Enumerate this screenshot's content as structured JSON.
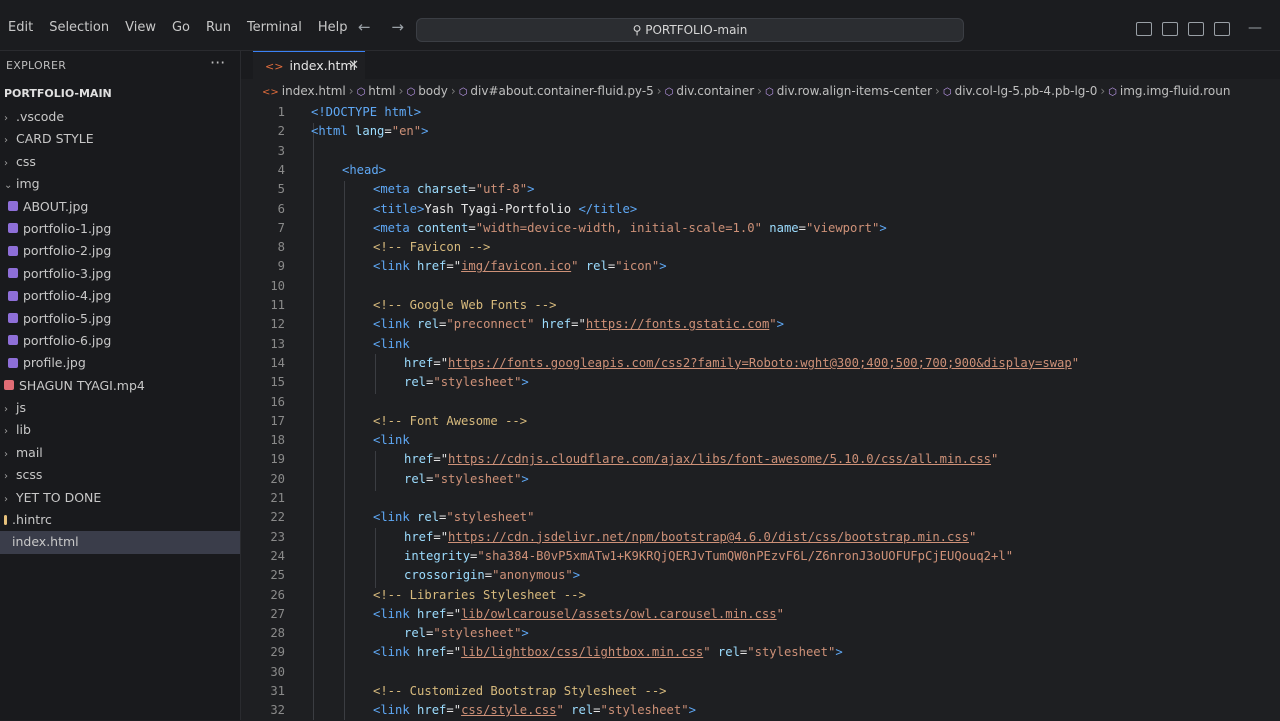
{
  "menu": [
    "Edit",
    "Selection",
    "View",
    "Go",
    "Run",
    "Terminal",
    "Help"
  ],
  "search": {
    "label": "PORTFOLIO-main"
  },
  "sidebar": {
    "header": "EXPLORER",
    "root": "PORTFOLIO-MAIN",
    "items": [
      {
        "label": ".vscode",
        "kind": "folder",
        "level": 0,
        "expanded": false
      },
      {
        "label": "CARD STYLE",
        "kind": "folder",
        "level": 0,
        "expanded": false
      },
      {
        "label": "css",
        "kind": "folder",
        "level": 0,
        "expanded": false
      },
      {
        "label": "img",
        "kind": "folder",
        "level": 0,
        "expanded": true
      },
      {
        "label": "ABOUT.jpg",
        "kind": "image",
        "level": 1
      },
      {
        "label": "portfolio-1.jpg",
        "kind": "image",
        "level": 1
      },
      {
        "label": "portfolio-2.jpg",
        "kind": "image",
        "level": 1
      },
      {
        "label": "portfolio-3.jpg",
        "kind": "image",
        "level": 1
      },
      {
        "label": "portfolio-4.jpg",
        "kind": "image",
        "level": 1
      },
      {
        "label": "portfolio-5.jpg",
        "kind": "image",
        "level": 1
      },
      {
        "label": "portfolio-6.jpg",
        "kind": "image",
        "level": 1
      },
      {
        "label": "profile.jpg",
        "kind": "image",
        "level": 1
      },
      {
        "label": "SHAGUN TYAGI.mp4",
        "kind": "video",
        "level": 0
      },
      {
        "label": "js",
        "kind": "folder",
        "level": 0,
        "expanded": false
      },
      {
        "label": "lib",
        "kind": "folder",
        "level": 0,
        "expanded": false
      },
      {
        "label": "mail",
        "kind": "folder",
        "level": 0,
        "expanded": false
      },
      {
        "label": "scss",
        "kind": "folder",
        "level": 0,
        "expanded": false
      },
      {
        "label": "YET TO DONE",
        "kind": "folder",
        "level": 0,
        "expanded": false
      },
      {
        "label": ".hintrc",
        "kind": "config",
        "level": 0
      },
      {
        "label": "index.html",
        "kind": "html",
        "level": 0,
        "active": true
      }
    ]
  },
  "tab": {
    "label": "index.html"
  },
  "breadcrumb": [
    "index.html",
    "html",
    "body",
    "div#about.container-fluid.py-5",
    "div.container",
    "div.row.align-items-center",
    "div.col-lg-5.pb-4.pb-lg-0",
    "img.img-fluid.roun"
  ],
  "code": [
    {
      "n": 1,
      "indent": 0,
      "parts": [
        [
          "tag",
          "<!DOCTYPE html>"
        ]
      ]
    },
    {
      "n": 2,
      "indent": 0,
      "parts": [
        [
          "tag",
          "<html "
        ],
        [
          "attr",
          "lang"
        ],
        [
          "plain",
          "="
        ],
        [
          "val",
          "\"en\""
        ],
        [
          "tag",
          ">"
        ]
      ]
    },
    {
      "n": 3,
      "indent": 0,
      "parts": []
    },
    {
      "n": 4,
      "indent": 1,
      "parts": [
        [
          "tag",
          "<head>"
        ]
      ]
    },
    {
      "n": 5,
      "indent": 2,
      "parts": [
        [
          "tag",
          "<meta "
        ],
        [
          "attr",
          "charset"
        ],
        [
          "plain",
          "="
        ],
        [
          "val",
          "\"utf-8\""
        ],
        [
          "tag",
          ">"
        ]
      ]
    },
    {
      "n": 6,
      "indent": 2,
      "parts": [
        [
          "tag",
          "<title>"
        ],
        [
          "plain",
          "Yash Tyagi-Portfolio "
        ],
        [
          "tag",
          "</title>"
        ]
      ]
    },
    {
      "n": 7,
      "indent": 2,
      "parts": [
        [
          "tag",
          "<meta "
        ],
        [
          "attr",
          "content"
        ],
        [
          "plain",
          "="
        ],
        [
          "val",
          "\"width=device-width, initial-scale=1.0\""
        ],
        [
          "plain",
          " "
        ],
        [
          "attr",
          "name"
        ],
        [
          "plain",
          "="
        ],
        [
          "val",
          "\"viewport\""
        ],
        [
          "tag",
          ">"
        ]
      ]
    },
    {
      "n": 8,
      "indent": 2,
      "parts": [
        [
          "cmt",
          "<!-- Favicon -->"
        ]
      ]
    },
    {
      "n": 9,
      "indent": 2,
      "parts": [
        [
          "tag",
          "<link "
        ],
        [
          "attr",
          "href"
        ],
        [
          "plain",
          "=\""
        ],
        [
          "url",
          "img/favicon.ico"
        ],
        [
          "val",
          "\""
        ],
        [
          "plain",
          " "
        ],
        [
          "attr",
          "rel"
        ],
        [
          "plain",
          "="
        ],
        [
          "val",
          "\"icon\""
        ],
        [
          "tag",
          ">"
        ]
      ]
    },
    {
      "n": 10,
      "indent": 0,
      "parts": []
    },
    {
      "n": 11,
      "indent": 2,
      "parts": [
        [
          "cmt",
          "<!-- Google Web Fonts -->"
        ]
      ]
    },
    {
      "n": 12,
      "indent": 2,
      "parts": [
        [
          "tag",
          "<link "
        ],
        [
          "attr",
          "rel"
        ],
        [
          "plain",
          "="
        ],
        [
          "val",
          "\"preconnect\""
        ],
        [
          "plain",
          " "
        ],
        [
          "attr",
          "href"
        ],
        [
          "plain",
          "=\""
        ],
        [
          "url",
          "https://fonts.gstatic.com"
        ],
        [
          "val",
          "\""
        ],
        [
          "tag",
          ">"
        ]
      ]
    },
    {
      "n": 13,
      "indent": 2,
      "parts": [
        [
          "tag",
          "<link"
        ]
      ]
    },
    {
      "n": 14,
      "indent": 3,
      "parts": [
        [
          "attr",
          "href"
        ],
        [
          "plain",
          "=\""
        ],
        [
          "url",
          "https://fonts.googleapis.com/css2?family=Roboto:wght@300;400;500;700;900&display=swap"
        ],
        [
          "val",
          "\""
        ]
      ]
    },
    {
      "n": 15,
      "indent": 3,
      "parts": [
        [
          "attr",
          "rel"
        ],
        [
          "plain",
          "="
        ],
        [
          "val",
          "\"stylesheet\""
        ],
        [
          "tag",
          ">"
        ]
      ]
    },
    {
      "n": 16,
      "indent": 0,
      "parts": []
    },
    {
      "n": 17,
      "indent": 2,
      "parts": [
        [
          "cmt",
          "<!-- Font Awesome -->"
        ]
      ]
    },
    {
      "n": 18,
      "indent": 2,
      "parts": [
        [
          "tag",
          "<link"
        ]
      ]
    },
    {
      "n": 19,
      "indent": 3,
      "parts": [
        [
          "attr",
          "href"
        ],
        [
          "plain",
          "=\""
        ],
        [
          "url",
          "https://cdnjs.cloudflare.com/ajax/libs/font-awesome/5.10.0/css/all.min.css"
        ],
        [
          "val",
          "\""
        ]
      ]
    },
    {
      "n": 20,
      "indent": 3,
      "parts": [
        [
          "attr",
          "rel"
        ],
        [
          "plain",
          "="
        ],
        [
          "val",
          "\"stylesheet\""
        ],
        [
          "tag",
          ">"
        ]
      ]
    },
    {
      "n": 21,
      "indent": 0,
      "parts": []
    },
    {
      "n": 22,
      "indent": 2,
      "parts": [
        [
          "tag",
          "<link "
        ],
        [
          "attr",
          "rel"
        ],
        [
          "plain",
          "="
        ],
        [
          "val",
          "\"stylesheet\""
        ]
      ]
    },
    {
      "n": 23,
      "indent": 3,
      "parts": [
        [
          "attr",
          "href"
        ],
        [
          "plain",
          "=\""
        ],
        [
          "url",
          "https://cdn.jsdelivr.net/npm/bootstrap@4.6.0/dist/css/bootstrap.min.css"
        ],
        [
          "val",
          "\""
        ]
      ]
    },
    {
      "n": 24,
      "indent": 3,
      "parts": [
        [
          "attr",
          "integrity"
        ],
        [
          "plain",
          "="
        ],
        [
          "val",
          "\"sha384-B0vP5xmATw1+K9KRQjQERJvTumQW0nPEzvF6L/Z6nronJ3oUOFUFpCjEUQouq2+l\""
        ]
      ]
    },
    {
      "n": 25,
      "indent": 3,
      "parts": [
        [
          "attr",
          "crossorigin"
        ],
        [
          "plain",
          "="
        ],
        [
          "val",
          "\"anonymous\""
        ],
        [
          "tag",
          ">"
        ]
      ]
    },
    {
      "n": 26,
      "indent": 2,
      "parts": [
        [
          "cmt",
          "<!-- Libraries Stylesheet -->"
        ]
      ]
    },
    {
      "n": 27,
      "indent": 2,
      "parts": [
        [
          "tag",
          "<link "
        ],
        [
          "attr",
          "href"
        ],
        [
          "plain",
          "=\""
        ],
        [
          "url",
          "lib/owlcarousel/assets/owl.carousel.min.css"
        ],
        [
          "val",
          "\""
        ]
      ]
    },
    {
      "n": 28,
      "indent": 3,
      "parts": [
        [
          "attr",
          "rel"
        ],
        [
          "plain",
          "="
        ],
        [
          "val",
          "\"stylesheet\""
        ],
        [
          "tag",
          ">"
        ]
      ]
    },
    {
      "n": 29,
      "indent": 2,
      "parts": [
        [
          "tag",
          "<link "
        ],
        [
          "attr",
          "href"
        ],
        [
          "plain",
          "=\""
        ],
        [
          "url",
          "lib/lightbox/css/lightbox.min.css"
        ],
        [
          "val",
          "\""
        ],
        [
          "plain",
          " "
        ],
        [
          "attr",
          "rel"
        ],
        [
          "plain",
          "="
        ],
        [
          "val",
          "\"stylesheet\""
        ],
        [
          "tag",
          ">"
        ]
      ]
    },
    {
      "n": 30,
      "indent": 0,
      "parts": []
    },
    {
      "n": 31,
      "indent": 2,
      "parts": [
        [
          "cmt",
          "<!-- Customized Bootstrap Stylesheet -->"
        ]
      ]
    },
    {
      "n": 32,
      "indent": 2,
      "parts": [
        [
          "tag",
          "<link "
        ],
        [
          "attr",
          "href"
        ],
        [
          "plain",
          "=\""
        ],
        [
          "url",
          "css/style.css"
        ],
        [
          "val",
          "\""
        ],
        [
          "plain",
          " "
        ],
        [
          "attr",
          "rel"
        ],
        [
          "plain",
          "="
        ],
        [
          "val",
          "\"stylesheet\""
        ],
        [
          "tag",
          ">"
        ]
      ]
    }
  ]
}
